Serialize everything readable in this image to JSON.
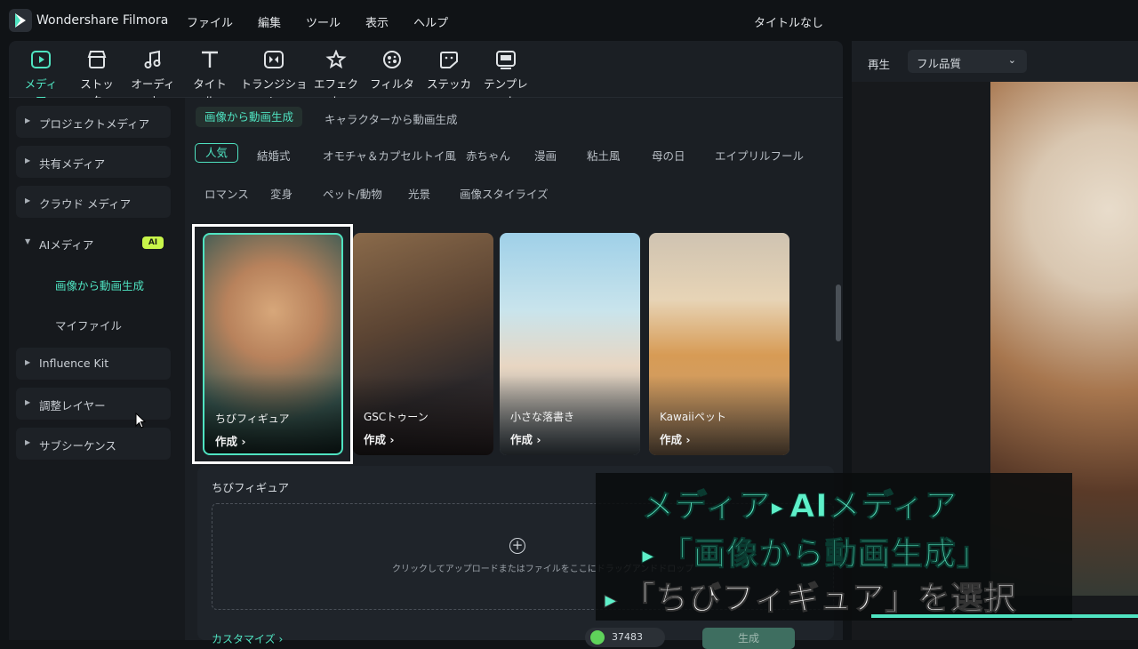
{
  "app": {
    "name": "Wondershare Filmora",
    "doc_title": "タイトルなし"
  },
  "menu": [
    "ファイル",
    "編集",
    "ツール",
    "表示",
    "ヘルプ"
  ],
  "toolbar": [
    {
      "label": "メディア",
      "icon": "media-icon",
      "active": true
    },
    {
      "label": "ストック",
      "icon": "stock-icon"
    },
    {
      "label": "オーディオ",
      "icon": "audio-icon"
    },
    {
      "label": "タイトル",
      "icon": "title-icon"
    },
    {
      "label": "トランジション",
      "icon": "transition-icon"
    },
    {
      "label": "エフェクト",
      "icon": "effect-icon"
    },
    {
      "label": "フィルター",
      "icon": "filter-icon"
    },
    {
      "label": "ステッカー",
      "icon": "sticker-icon"
    },
    {
      "label": "テンプレート",
      "icon": "template-icon"
    }
  ],
  "sidebar": {
    "items": [
      {
        "label": "プロジェクトメディア"
      },
      {
        "label": "共有メディア"
      },
      {
        "label": "クラウド メディア"
      },
      {
        "label": "AIメディア",
        "badge": "AI"
      },
      {
        "label": "Influence Kit"
      },
      {
        "label": "調整レイヤー"
      },
      {
        "label": "サブシーケンス"
      }
    ],
    "sub": [
      {
        "label": "画像から動画生成",
        "active": true
      },
      {
        "label": "マイファイル"
      }
    ]
  },
  "tabs": [
    "画像から動画生成",
    "キャラクターから動画生成"
  ],
  "categories": {
    "row1": [
      "人気",
      "結婚式",
      "オモチャ＆カプセルトイ風",
      "赤ちゃん",
      "漫画",
      "粘土風",
      "母の日",
      "エイプリルフール"
    ],
    "row2": [
      "ロマンス",
      "変身",
      "ペット/動物",
      "光景",
      "画像スタイライズ"
    ]
  },
  "cards": [
    {
      "name": "ちびフィギュア",
      "action": "作成 ›"
    },
    {
      "name": "GSCトゥーン",
      "action": "作成 ›"
    },
    {
      "name": "小さな落書き",
      "action": "作成 ›"
    },
    {
      "name": "Kawaiiペット",
      "action": "作成 ›"
    }
  ],
  "panel": {
    "title": "ちびフィギュア",
    "drop_text": "クリックしてアップロードまたはファイルをここにドラッグアンドドロップ",
    "customize": "カスタマイズ ›",
    "credits": "37483",
    "generate": "生成"
  },
  "preview": {
    "label": "再生",
    "quality": "フル品質"
  },
  "overlay": {
    "line1_a": "メディア",
    "line1_b": "AIメディア",
    "line2": "「画像から動画生成」",
    "line3": "「ちびフィギュア」を選択"
  },
  "colors": {
    "accent": "#4fe3c1",
    "ai_badge": "#c8f54a",
    "overlay_text": "#5ef0c9"
  }
}
